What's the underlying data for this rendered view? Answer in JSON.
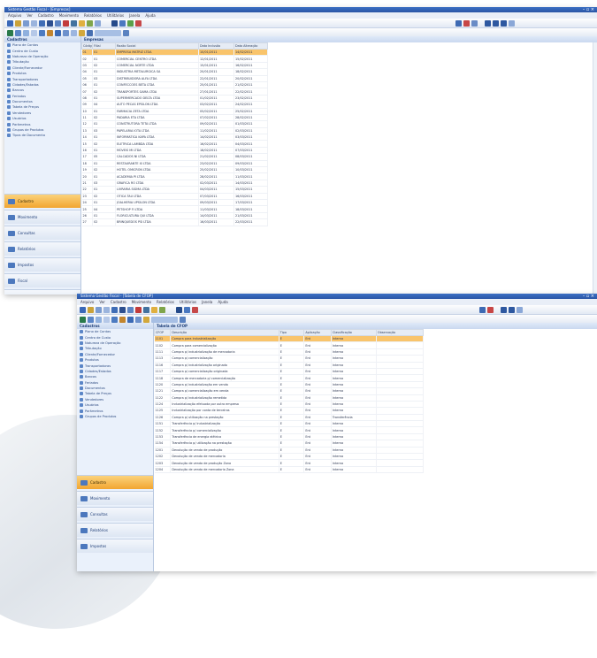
{
  "window1": {
    "title": "Sistema Gestão Fiscal - [Empresas]",
    "menu": [
      "Arquivo",
      "Ver",
      "Cadastro",
      "Movimento",
      "Relatórios",
      "Utilitários",
      "Janela",
      "Ajuda"
    ],
    "sidebar_title": "Cadastros",
    "nav_items": [
      "Plano de Contas",
      "Centro de Custo",
      "Natureza de Operação",
      "Tributação",
      "Cliente/Fornecedor",
      "Produtos",
      "Transportadoras",
      "Cidades/Estados",
      "Bancos",
      "Feriados",
      "Documentos",
      "Tabela de Preços",
      "Vendedores",
      "Usuários",
      "Parâmetros",
      "Grupos de Produtos",
      "Tipos de Documento"
    ],
    "sections": [
      "Cadastro",
      "Movimento",
      "Consultas",
      "Relatórios",
      "Impostos",
      "Fiscal",
      "Contabilidade"
    ],
    "main_title": "Empresas",
    "columns": [
      "Código",
      "Filial",
      "Razão Social",
      "Data Inclusão",
      "Data Alteração"
    ],
    "rows": [
      [
        "01",
        "01",
        "EMPRESA MATRIZ LTDA",
        "10/01/2011",
        "14/02/2011"
      ],
      [
        "02",
        "01",
        "COMERCIAL CENTRO LTDA",
        "12/01/2011",
        "15/02/2011"
      ],
      [
        "03",
        "02",
        "COMERCIAL NORTE LTDA",
        "15/01/2011",
        "16/02/2011"
      ],
      [
        "04",
        "01",
        "INDUSTRIA METALURGICA SA",
        "20/01/2011",
        "18/02/2011"
      ],
      [
        "05",
        "03",
        "DISTRIBUIDORA ALFA LTDA",
        "22/01/2011",
        "20/02/2011"
      ],
      [
        "06",
        "01",
        "CONFECCOES BETA LTDA",
        "25/01/2011",
        "21/02/2011"
      ],
      [
        "07",
        "02",
        "TRANSPORTES GAMA LTDA",
        "27/01/2011",
        "22/02/2011"
      ],
      [
        "08",
        "01",
        "SUPERMERCADO DELTA LTDA",
        "01/02/2011",
        "23/02/2011"
      ],
      [
        "09",
        "04",
        "AUTO PECAS EPSILON LTDA",
        "03/02/2011",
        "24/02/2011"
      ],
      [
        "10",
        "01",
        "FARMACIA ZETA LTDA",
        "05/02/2011",
        "25/02/2011"
      ],
      [
        "11",
        "02",
        "PADARIA ETA LTDA",
        "07/02/2011",
        "28/02/2011"
      ],
      [
        "12",
        "01",
        "CONSTRUTORA TETA LTDA",
        "09/02/2011",
        "01/03/2011"
      ],
      [
        "13",
        "03",
        "PAPELARIA IOTA LTDA",
        "11/02/2011",
        "02/03/2011"
      ],
      [
        "14",
        "01",
        "INFORMATICA KAPA LTDA",
        "14/02/2011",
        "03/03/2011"
      ],
      [
        "15",
        "02",
        "ELETRICA LAMBDA LTDA",
        "16/02/2011",
        "04/03/2011"
      ],
      [
        "16",
        "01",
        "MOVEIS MI LTDA",
        "18/02/2011",
        "07/03/2011"
      ],
      [
        "17",
        "05",
        "CALCADOS NI LTDA",
        "21/02/2011",
        "08/03/2011"
      ],
      [
        "18",
        "01",
        "RESTAURANTE XI LTDA",
        "23/02/2011",
        "09/03/2011"
      ],
      [
        "19",
        "02",
        "HOTEL OMICRON LTDA",
        "25/02/2011",
        "10/03/2011"
      ],
      [
        "20",
        "01",
        "ACADEMIA PI LTDA",
        "28/02/2011",
        "11/03/2011"
      ],
      [
        "21",
        "03",
        "GRAFICA RO LTDA",
        "02/03/2011",
        "14/03/2011"
      ],
      [
        "22",
        "01",
        "LIVRARIA SIGMA LTDA",
        "04/03/2011",
        "15/03/2011"
      ],
      [
        "23",
        "02",
        "OTICA TAU LTDA",
        "07/03/2011",
        "16/03/2011"
      ],
      [
        "24",
        "01",
        "JOALHERIA UPSILON LTDA",
        "09/03/2011",
        "17/03/2011"
      ],
      [
        "25",
        "04",
        "PETSHOP FI LTDA",
        "11/03/2011",
        "18/03/2011"
      ],
      [
        "26",
        "01",
        "FLORICULTURA QUI LTDA",
        "14/03/2011",
        "21/03/2011"
      ],
      [
        "27",
        "02",
        "BRINQUEDOS PSI LTDA",
        "16/03/2011",
        "22/03/2011"
      ]
    ]
  },
  "window2": {
    "title": "Sistema Gestão Fiscal - [Tabela de CFOP]",
    "menu": [
      "Arquivo",
      "Ver",
      "Cadastro",
      "Movimento",
      "Relatórios",
      "Utilitários",
      "Janela",
      "Ajuda"
    ],
    "sidebar_title": "Cadastros",
    "nav_items": [
      "Plano de Contas",
      "Centro de Custo",
      "Natureza de Operação",
      "Tributação",
      "Cliente/Fornecedor",
      "Produtos",
      "Transportadoras",
      "Cidades/Estados",
      "Bancos",
      "Feriados",
      "Documentos",
      "Tabela de Preços",
      "Vendedores",
      "Usuários",
      "Parâmetros",
      "Grupos de Produtos"
    ],
    "sections": [
      "Cadastro",
      "Movimento",
      "Consultas",
      "Relatórios",
      "Impostos"
    ],
    "main_title": "Tabela de CFOP",
    "columns": [
      "CFOP",
      "Descrição",
      "Tipo",
      "Aplicação",
      "Classificação",
      "Observação"
    ],
    "rows": [
      [
        "1101",
        "Compra para industrialização",
        "E",
        "Ent",
        "Interna",
        ""
      ],
      [
        "1102",
        "Compra para comercialização",
        "E",
        "Ent",
        "Interna",
        ""
      ],
      [
        "1111",
        "Compra p/ industrialização de mercadoria",
        "E",
        "Ent",
        "Interna",
        ""
      ],
      [
        "1113",
        "Compra p/ comercialização",
        "E",
        "Ent",
        "Interna",
        ""
      ],
      [
        "1116",
        "Compra p/ industrialização originada",
        "E",
        "Ent",
        "Interna",
        ""
      ],
      [
        "1117",
        "Compra p/ comercialização originada",
        "E",
        "Ent",
        "Interna",
        ""
      ],
      [
        "1118",
        "Compra de mercadoria p/ comercialização",
        "E",
        "Ent",
        "Interna",
        ""
      ],
      [
        "1120",
        "Compra p/ industrialização em venda",
        "E",
        "Ent",
        "Interna",
        ""
      ],
      [
        "1121",
        "Compra p/ comercialização em venda",
        "E",
        "Ent",
        "Interna",
        ""
      ],
      [
        "1122",
        "Compra p/ industrialização remetida",
        "E",
        "Ent",
        "Interna",
        ""
      ],
      [
        "1124",
        "Industrialização efetuada por outra empresa",
        "E",
        "Ent",
        "Interna",
        ""
      ],
      [
        "1125",
        "Industrialização por conta de terceiros",
        "E",
        "Ent",
        "Interna",
        ""
      ],
      [
        "1126",
        "Compra p/ utilização na prestação",
        "E",
        "Ent",
        "Transferência",
        ""
      ],
      [
        "1151",
        "Transferência p/ industrialização",
        "E",
        "Ent",
        "Interna",
        ""
      ],
      [
        "1152",
        "Transferência p/ comercialização",
        "E",
        "Ent",
        "Interna",
        ""
      ],
      [
        "1153",
        "Transferência de energia elétrica",
        "E",
        "Ent",
        "Interna",
        ""
      ],
      [
        "1154",
        "Transferência p/ utilização na prestação",
        "E",
        "Ent",
        "Interna",
        ""
      ],
      [
        "1201",
        "Devolução de venda de produção",
        "E",
        "Ent",
        "Interna",
        ""
      ],
      [
        "1202",
        "Devolução de venda de mercadoria",
        "E",
        "Ent",
        "Interna",
        ""
      ],
      [
        "1203",
        "Devolução de venda de produção Zona",
        "E",
        "Ent",
        "Interna",
        ""
      ],
      [
        "1204",
        "Devolução de venda de mercadoria Zona",
        "E",
        "Ent",
        "Interna",
        ""
      ]
    ]
  }
}
